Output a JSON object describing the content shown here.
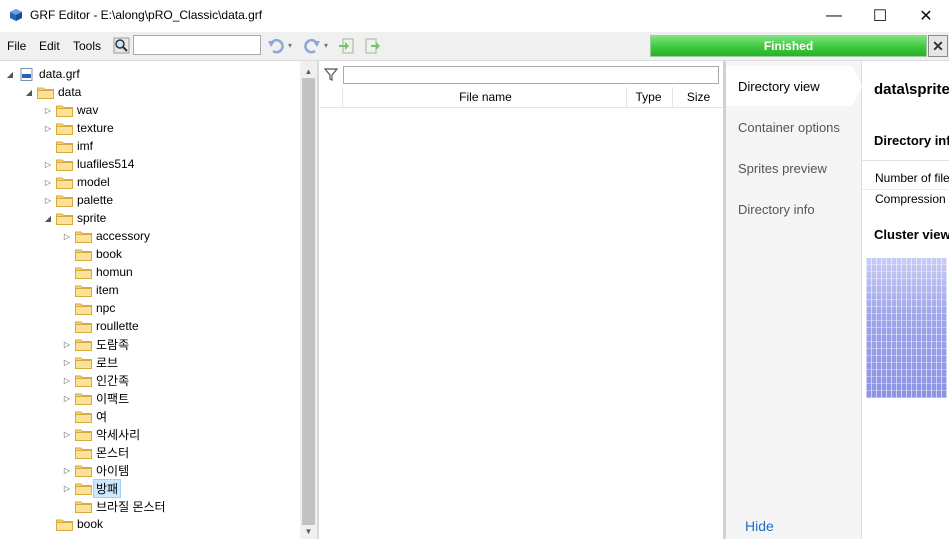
{
  "window": {
    "title": "GRF Editor - E:\\along\\pRO_Classic\\data.grf",
    "minimize": "—",
    "maximize": "☐",
    "close": "✕"
  },
  "menu": {
    "file": "File",
    "edit": "Edit",
    "tools": "Tools"
  },
  "toolbar": {
    "search_value": "",
    "progress_label": "Finished",
    "progress_value": 1.0,
    "progress_close": "✕"
  },
  "tree": {
    "nodes": [
      {
        "label": "data.grf",
        "expand": "expanded",
        "icon": "grf"
      },
      {
        "label": "data",
        "expand": "expanded",
        "icon": "folder"
      },
      {
        "label": "wav",
        "expand": "collapsed",
        "icon": "folder"
      },
      {
        "label": "texture",
        "expand": "collapsed",
        "icon": "folder"
      },
      {
        "label": "imf",
        "expand": "none",
        "icon": "folder"
      },
      {
        "label": "luafiles514",
        "expand": "collapsed",
        "icon": "folder"
      },
      {
        "label": "model",
        "expand": "collapsed",
        "icon": "folder"
      },
      {
        "label": "palette",
        "expand": "collapsed",
        "icon": "folder"
      },
      {
        "label": "sprite",
        "expand": "expanded",
        "icon": "folder"
      },
      {
        "label": "accessory",
        "expand": "collapsed",
        "icon": "folder"
      },
      {
        "label": "book",
        "expand": "none",
        "icon": "folder"
      },
      {
        "label": "homun",
        "expand": "none",
        "icon": "folder"
      },
      {
        "label": "item",
        "expand": "none",
        "icon": "folder"
      },
      {
        "label": "npc",
        "expand": "none",
        "icon": "folder"
      },
      {
        "label": "roullette",
        "expand": "none",
        "icon": "folder"
      },
      {
        "label": "도람족",
        "expand": "collapsed",
        "icon": "folder"
      },
      {
        "label": "로브",
        "expand": "collapsed",
        "icon": "folder"
      },
      {
        "label": "인간족",
        "expand": "collapsed",
        "icon": "folder"
      },
      {
        "label": "이팩트",
        "expand": "collapsed",
        "icon": "folder"
      },
      {
        "label": "여",
        "expand": "none",
        "icon": "folder"
      },
      {
        "label": "악세사리",
        "expand": "collapsed",
        "icon": "folder"
      },
      {
        "label": "몬스터",
        "expand": "none",
        "icon": "folder"
      },
      {
        "label": "아이템",
        "expand": "collapsed",
        "icon": "folder"
      },
      {
        "label": "방패",
        "expand": "collapsed",
        "icon": "folder",
        "selected": true
      },
      {
        "label": "브라질 몬스터",
        "expand": "none",
        "icon": "folder"
      },
      {
        "label": "book",
        "expand": "none",
        "icon": "folder"
      }
    ]
  },
  "filelist": {
    "filter_value": "",
    "columns": {
      "name": "File name",
      "type": "Type",
      "size": "Size"
    }
  },
  "nav": {
    "items": [
      "Directory view",
      "Container options",
      "Sprites preview",
      "Directory info"
    ],
    "active": "Directory view",
    "hide": "Hide"
  },
  "details": {
    "path": "data\\sprite",
    "section_info": "Directory info",
    "num_files_label": "Number of files",
    "compression_label": "Compression ratio",
    "section_cluster": "Cluster view"
  },
  "colors": {
    "accent": "#1f6fbf",
    "progress": "#3fc73f",
    "cluster": "#9fa5ea",
    "selection": "#cce8ff"
  },
  "icons": {
    "app": "grf-cube-icon",
    "search": "search-icon",
    "undo": "undo-icon",
    "redo": "redo-icon",
    "add": "add-file-icon",
    "merge": "merge-file-icon",
    "filter": "filter-icon",
    "folder": "folder-icon"
  }
}
